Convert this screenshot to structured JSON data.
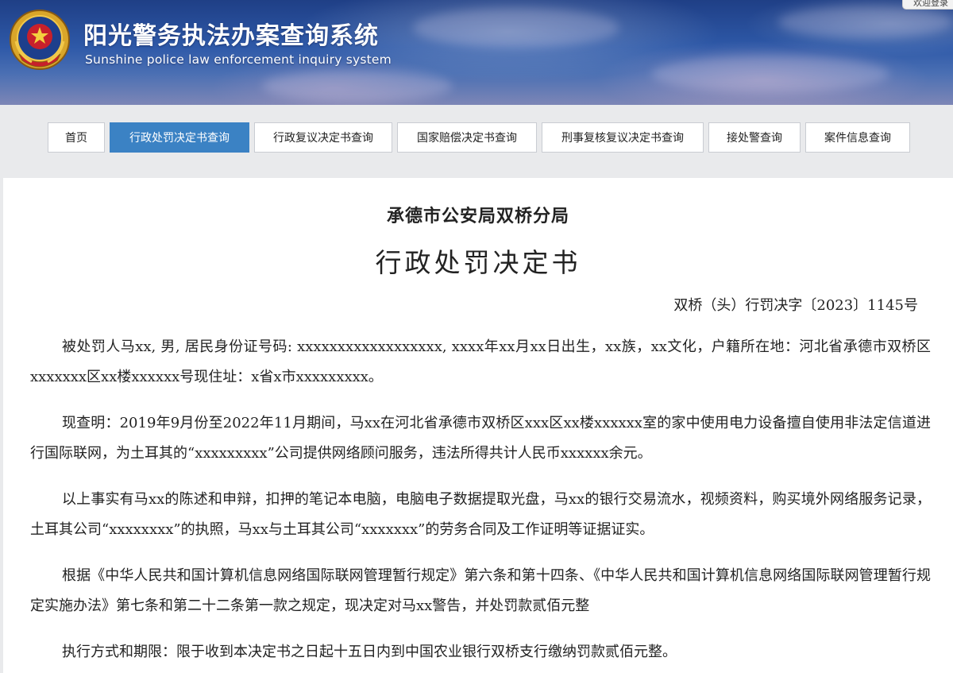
{
  "header": {
    "title_cn": "阳光警务执法办案查询系统",
    "title_en": "Sunshine police law enforcement inquiry system",
    "welcome_label": "欢迎登录"
  },
  "nav": {
    "tabs": [
      {
        "label": "首页",
        "active": false
      },
      {
        "label": "行政处罚决定书查询",
        "active": true
      },
      {
        "label": "行政复议决定书查询",
        "active": false
      },
      {
        "label": "国家赔偿决定书查询",
        "active": false
      },
      {
        "label": "刑事复核复议决定书查询",
        "active": false
      },
      {
        "label": "接处警查询",
        "active": false
      },
      {
        "label": "案件信息查询",
        "active": false
      }
    ]
  },
  "document": {
    "org": "承德市公安局双桥分局",
    "title": "行政处罚决定书",
    "number": "双桥（头）行罚决字〔2023〕1145号",
    "paragraphs": [
      "被处罚人马xx, 男, 居民身份证号码: xxxxxxxxxxxxxxxxxx, xxxx年xx月xx日出生，xx族，xx文化，户籍所在地：河北省承德市双桥区xxxxxxx区xx楼xxxxxx号现住址：x省x市xxxxxxxxx。",
      "现查明：2019年9月份至2022年11月期间，马xx在河北省承德市双桥区xxx区xx楼xxxxxx室的家中使用电力设备擅自使用非法定信道进行国际联网，为土耳其的“xxxxxxxxx”公司提供网络顾问服务，违法所得共计人民币xxxxxx余元。",
      "以上事实有马xx的陈述和申辩，扣押的笔记本电脑，电脑电子数据提取光盘，马xx的银行交易流水，视频资料，购买境外网络服务记录，土耳其公司“xxxxxxxx”的执照，马xx与土耳其公司“xxxxxxx”的劳务合同及工作证明等证据证实。",
      "根据《中华人民共和国计算机信息网络国际联网管理暂行规定》第六条和第十四条、《中华人民共和国计算机信息网络国际联网管理暂行规定实施办法》第七条和第二十二条第一款之规定，现决定对马xx警告，并处罚款贰佰元整",
      "执行方式和期限：限于收到本决定书之日起十五日内到中国农业银行双桥支行缴纳罚款贰佰元整。"
    ]
  },
  "colors": {
    "active_tab": "#3b82c4",
    "banner": "#2e59a8"
  },
  "icons": {
    "emblem": "police-emblem-icon"
  }
}
